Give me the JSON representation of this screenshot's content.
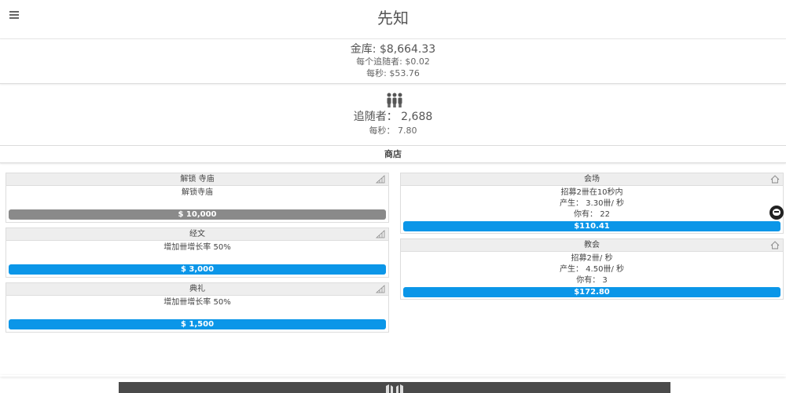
{
  "header": {
    "title": "先知",
    "menu_icon": "hamburger-menu-icon"
  },
  "treasury": {
    "label": "金库: $8,664.33",
    "per_follower": "每个追随者: $0.02",
    "per_second": "每秒: $53.76"
  },
  "followers": {
    "icon": "people-icon",
    "count_label": "追随者：  2,688",
    "rate_label": "每秒：  7.80"
  },
  "shop": {
    "title": "商店",
    "upgrades": [
      {
        "title": "解锁 寺庙",
        "desc": "解锁寺庙",
        "price": "$ 10,000",
        "state": "locked",
        "icon": "signal-bars-icon"
      },
      {
        "title": "经文",
        "desc": "增加卌增长率 50%",
        "price": "$ 3,000",
        "state": "available",
        "icon": "signal-bars-icon"
      },
      {
        "title": "典礼",
        "desc": "增加卌增长率 50%",
        "price": "$ 1,500",
        "state": "available",
        "icon": "signal-bars-icon"
      }
    ],
    "buildings": [
      {
        "title": "会场",
        "line1": "招募2卌在10秒内",
        "line2": "产生：  3.30卌/ 秒",
        "line3": "你有：  22",
        "price": "$110.41",
        "icon": "house-icon"
      },
      {
        "title": "教会",
        "line1": "招募2卌/ 秒",
        "line2": "产生：  4.50卌/ 秒",
        "line3": "你有：  3",
        "price": "$172.80",
        "icon": "house-icon"
      }
    ]
  },
  "colors": {
    "accent": "#0b96e8",
    "locked": "#8a8a8a",
    "header_bg": "#eeeeee",
    "bottom_bar": "#4a4a4a"
  },
  "side_icon": "octocat-icon",
  "bottom_icon": "book-icon"
}
